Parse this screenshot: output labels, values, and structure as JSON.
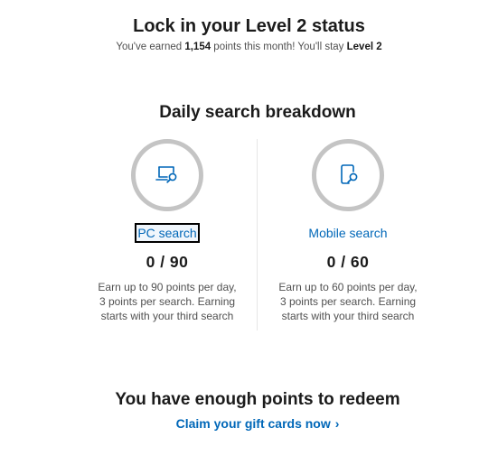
{
  "status": {
    "title": "Lock in your Level 2 status",
    "sub_prefix": "You've earned ",
    "points": "1,154",
    "sub_middle": " points this month! You'll stay ",
    "level": "Level 2"
  },
  "breakdown": {
    "title": "Daily search breakdown",
    "pc": {
      "label": "PC search",
      "count": "0 / 90",
      "progress": 0,
      "desc_lines": [
        "Earn up to 90 points per day,",
        "3 points per search. Earning",
        "starts with your third search"
      ]
    },
    "mobile": {
      "label": "Mobile search",
      "count": "0 / 60",
      "progress": 0,
      "desc_lines": [
        "Earn up to 60 points per day,",
        "3 points per search. Earning",
        "starts with your third search"
      ]
    }
  },
  "redeem": {
    "title": "You have enough points to redeem",
    "link": "Claim your gift cards now",
    "chevron": "›"
  },
  "colors": {
    "accent": "#0067b8",
    "ring": "#c4c4c4",
    "text": "#1b1b1b",
    "muted": "#505050"
  },
  "icons": {
    "pc": "laptop-search-icon",
    "mobile": "phone-search-icon"
  }
}
